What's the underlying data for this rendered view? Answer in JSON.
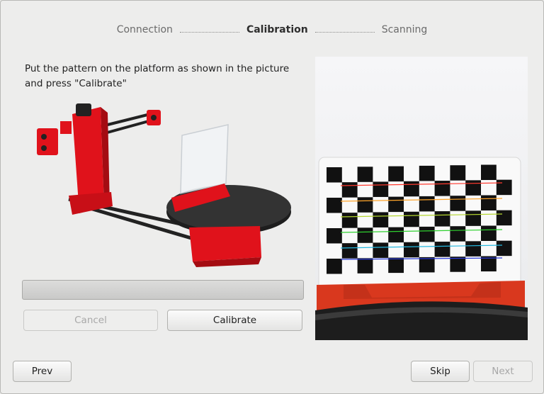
{
  "wizard": {
    "steps": [
      {
        "label": "Connection",
        "active": false
      },
      {
        "label": "Calibration",
        "active": true
      },
      {
        "label": "Scanning",
        "active": false
      }
    ]
  },
  "calibration": {
    "instruction": "Put the pattern on the platform as shown in the picture and press \"Calibrate\"",
    "progress": 0,
    "cancel_label": "Cancel",
    "calibrate_label": "Calibrate"
  },
  "nav": {
    "prev_label": "Prev",
    "skip_label": "Skip",
    "next_label": "Next"
  },
  "colors": {
    "scanner_red": "#e0121b",
    "platform_dark": "#2b2b2b",
    "accent": "#4a90d9"
  }
}
